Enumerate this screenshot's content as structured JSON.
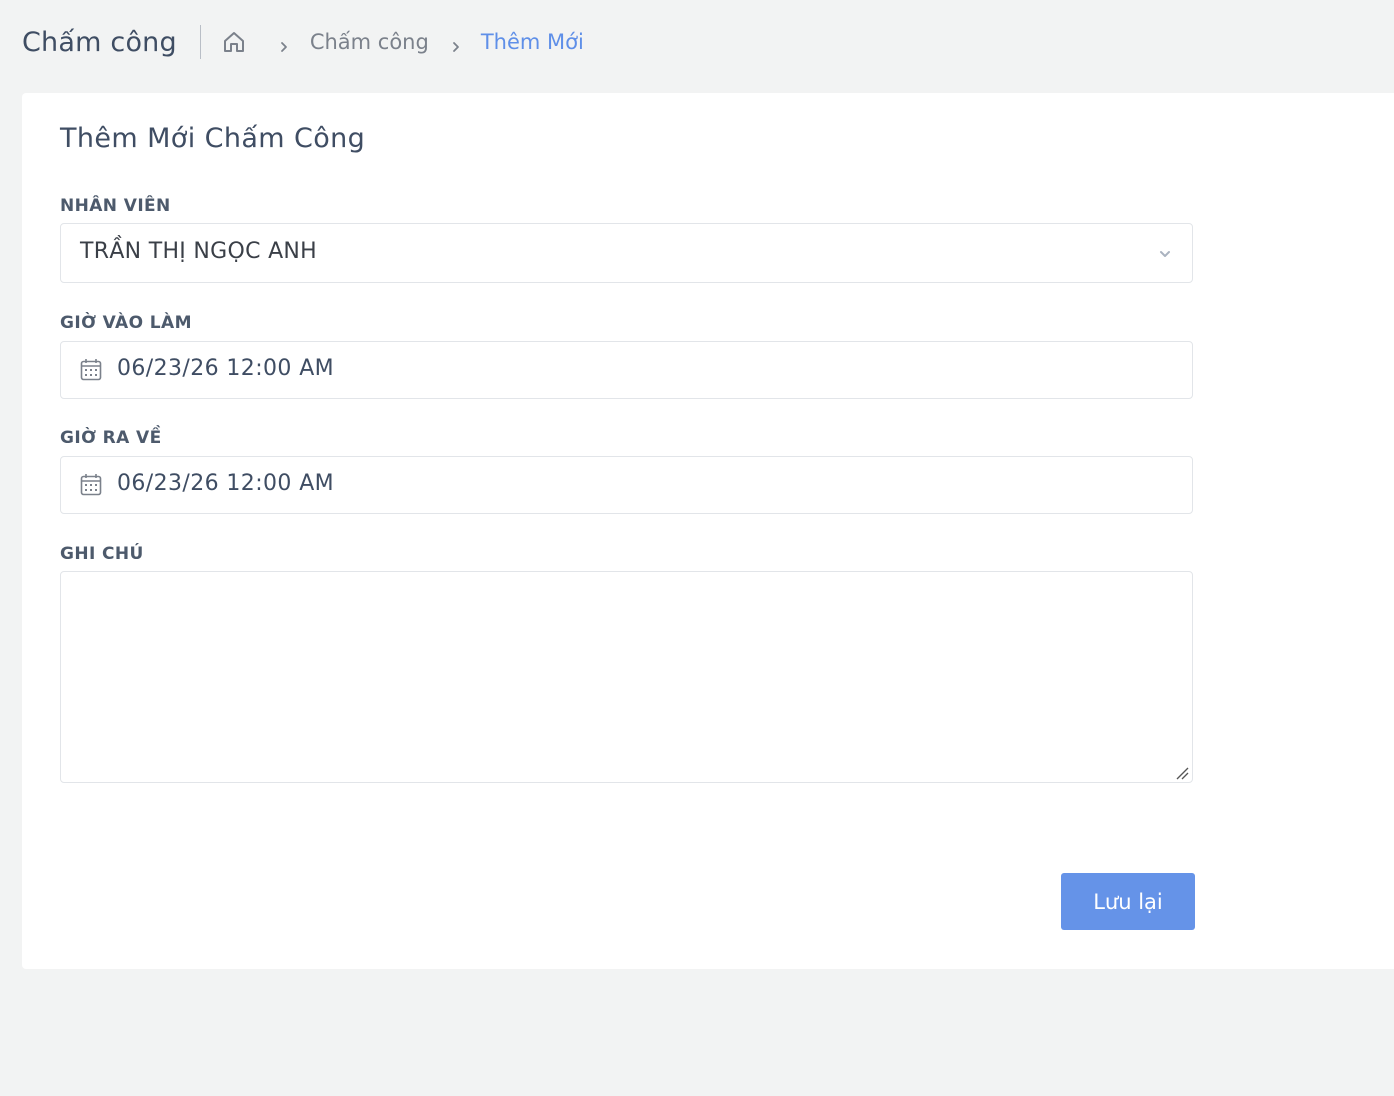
{
  "header": {
    "page_title": "Chấm công",
    "breadcrumb": {
      "home_icon": "home-icon",
      "items": [
        "Chấm công",
        "Thêm Mới"
      ]
    }
  },
  "form": {
    "title": "Thêm Mới Chấm Công",
    "employee": {
      "label": "NHÂN VIÊN",
      "value": "TRẦN THỊ NGỌC ANH"
    },
    "check_in": {
      "label": "GIỜ VÀO LÀM",
      "value": "06/23/26 12:00 AM"
    },
    "check_out": {
      "label": "GIỜ RA VỀ",
      "value": "06/23/26 12:00 AM"
    },
    "note": {
      "label": "GHI CHÚ",
      "value": ""
    },
    "save_label": "Lưu lại"
  },
  "colors": {
    "accent": "#6593e8",
    "background": "#f2f3f3",
    "card": "#ffffff",
    "text": "#3f4d63"
  }
}
